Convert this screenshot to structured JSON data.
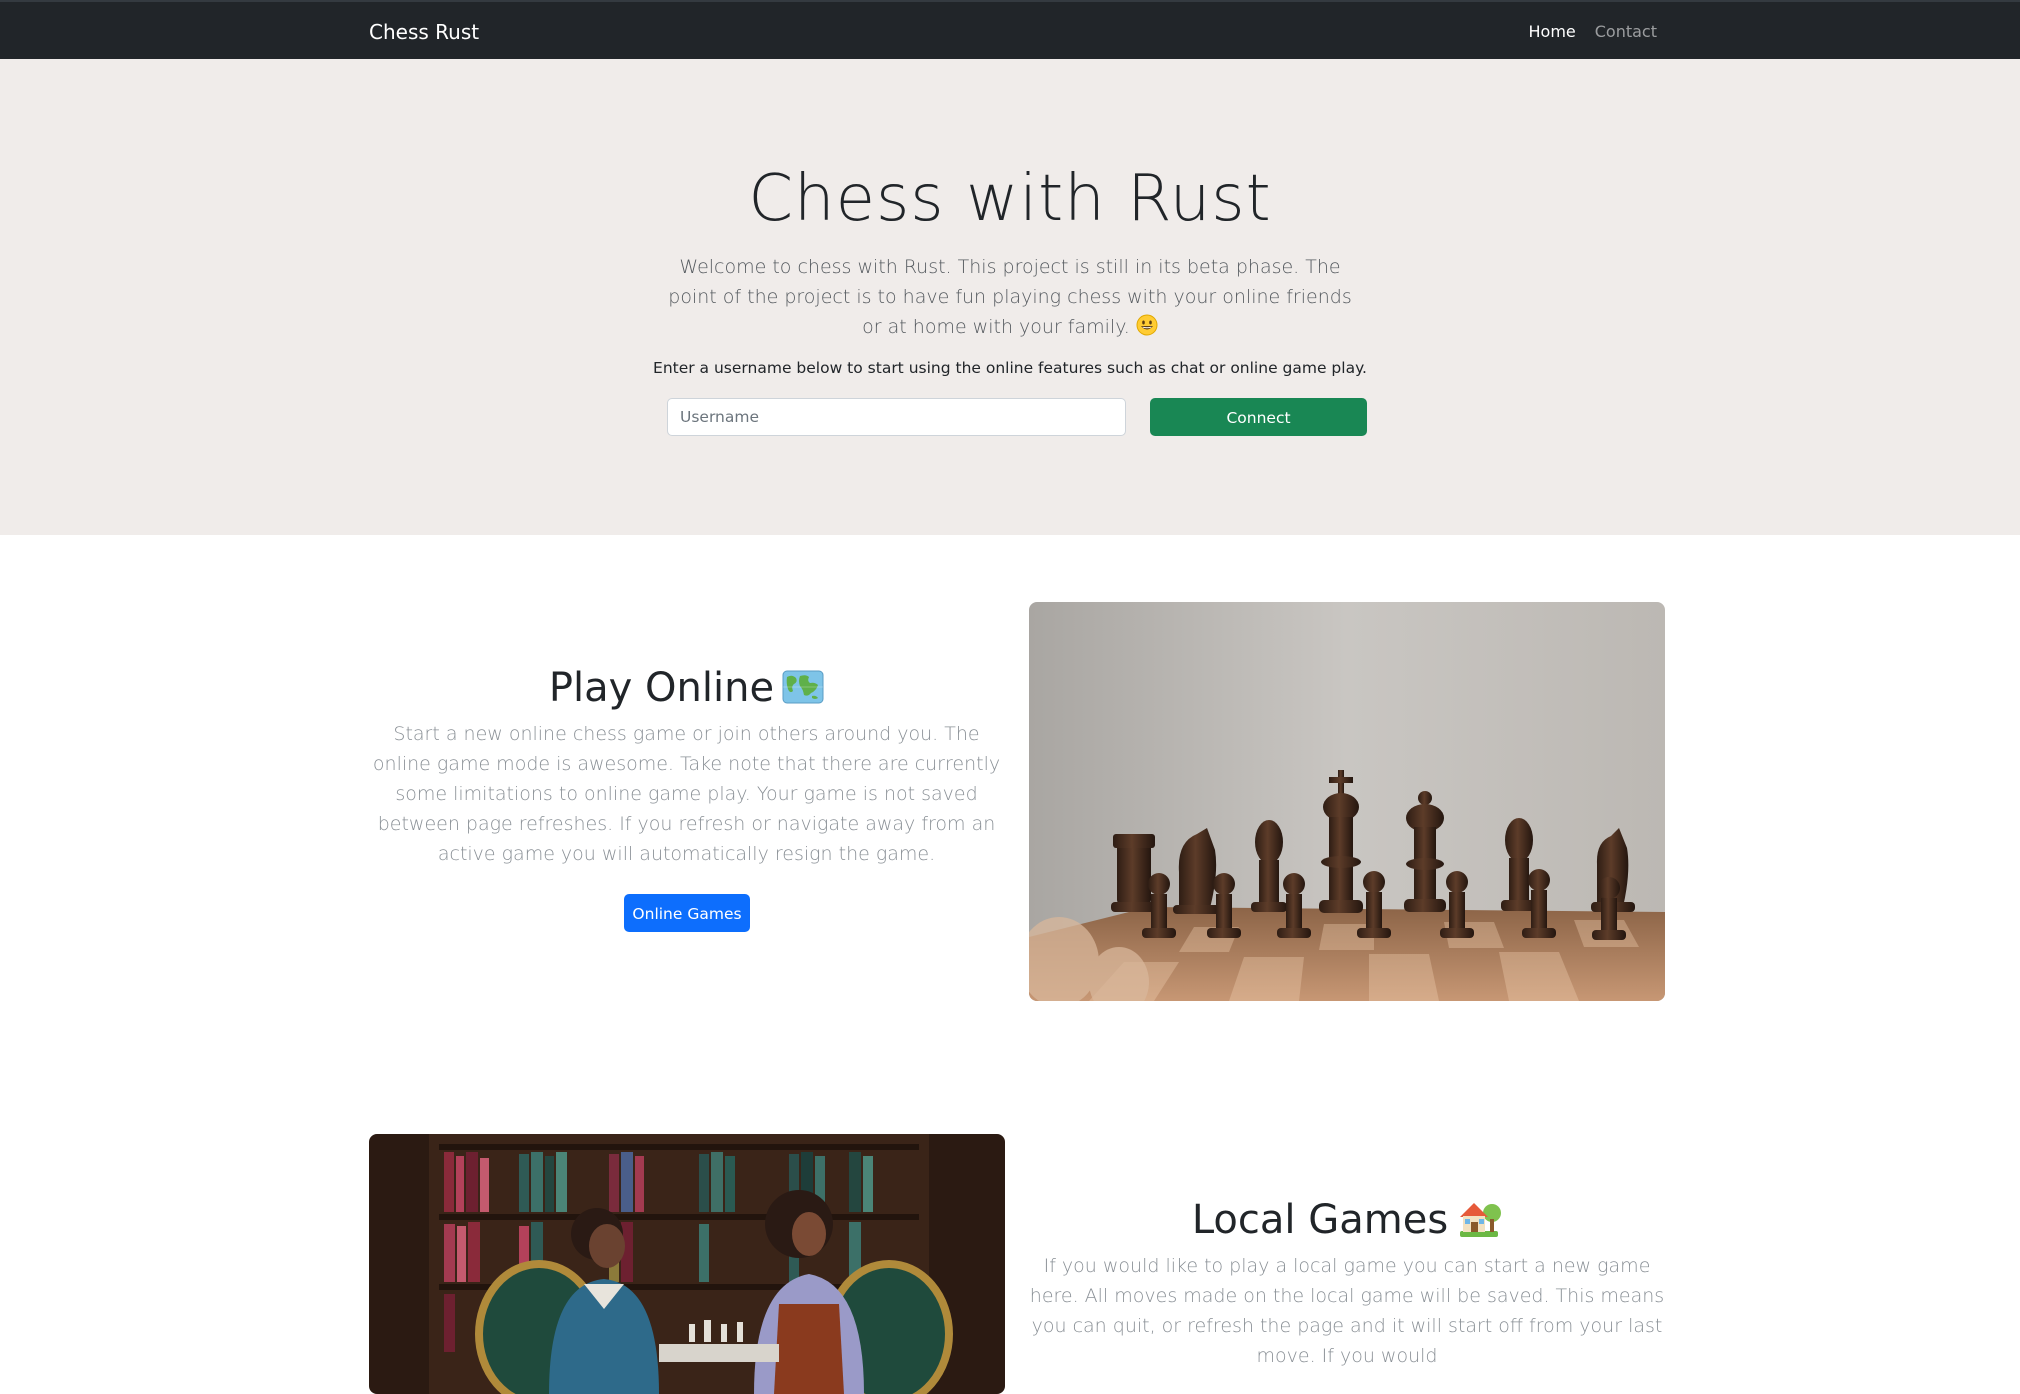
{
  "navbar": {
    "brand": "Chess Rust",
    "links": [
      {
        "label": "Home",
        "active": true
      },
      {
        "label": "Contact",
        "active": false
      }
    ]
  },
  "hero": {
    "title": "Chess with Rust",
    "lead": "Welcome to chess with Rust. This project is still in its beta phase. The point of the project is to have fun playing chess with your online friends or at home with your family.",
    "lead_icon": "grinning-face-emoji",
    "note": "Enter a username below to start using the online features such as chat or online game play.",
    "username_placeholder": "Username",
    "connect_label": "Connect"
  },
  "online_section": {
    "title": "Play Online",
    "title_icon": "world-map-emoji",
    "text": "Start a new online chess game or join others around you. The online game mode is awesome. Take note that there are currently some limitations to online game play. Your game is not saved between page refreshes. If you refresh or navigate away from an active game you will automatically resign the game.",
    "button_label": "Online Games",
    "image": "chess-pieces-photo"
  },
  "local_section": {
    "title": "Local Games",
    "title_icon": "house-with-garden-emoji",
    "text": "If you would like to play a local game you can start a new game here. All moves made on the local game will be saved. This means you can quit, or refresh the page and it will start off from your last move. If you would",
    "image": "people-playing-chess-library-photo"
  },
  "colors": {
    "navbar_bg": "#212529",
    "hero_bg": "#f0ecea",
    "connect_btn": "#198754",
    "online_btn": "#0d6efd"
  }
}
